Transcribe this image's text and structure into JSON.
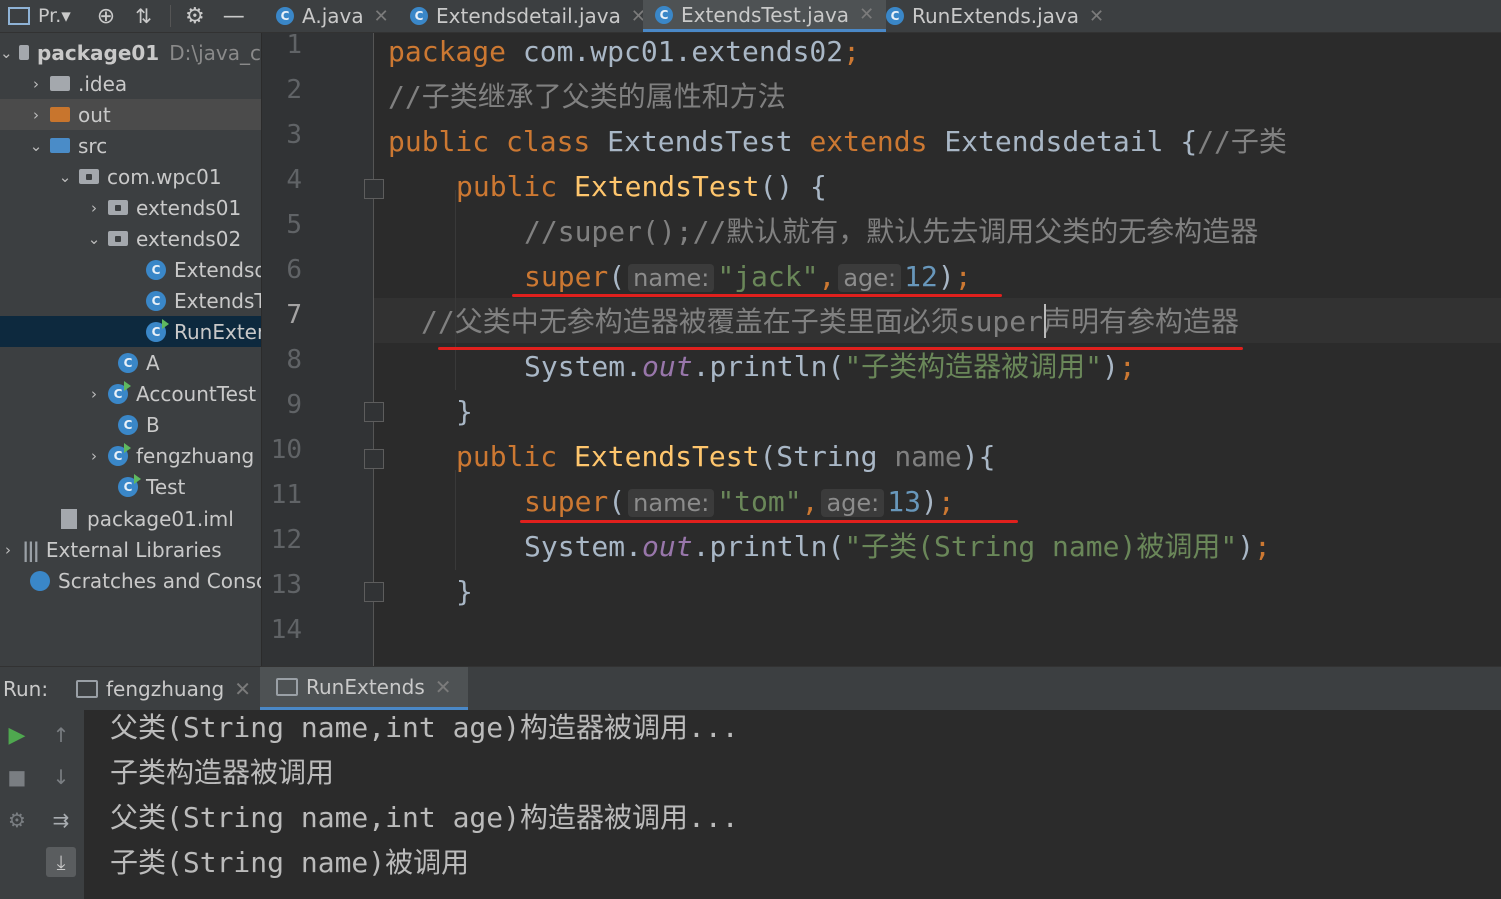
{
  "toolbar": {
    "project_label": "Pr.▾"
  },
  "tabs": [
    {
      "label": "A.java",
      "active": false
    },
    {
      "label": "Extendsdetail.java",
      "active": false
    },
    {
      "label": "ExtendsTest.java",
      "active": true
    },
    {
      "label": "RunExtends.java",
      "active": false
    }
  ],
  "tree": [
    {
      "label": "package01",
      "hint": "D:\\java_c",
      "icon": "module-folder-icon"
    },
    {
      "label": ".idea",
      "icon": "folder-icon"
    },
    {
      "label": "out",
      "icon": "folder-icon"
    },
    {
      "label": "src",
      "icon": "source-folder-icon"
    },
    {
      "label": "com.wpc01",
      "icon": "package-icon"
    },
    {
      "label": "extends01",
      "icon": "package-icon"
    },
    {
      "label": "extends02",
      "icon": "package-icon"
    },
    {
      "label": "Extendsd",
      "icon": "class-icon"
    },
    {
      "label": "ExtendsT",
      "icon": "class-icon"
    },
    {
      "label": "RunExten",
      "icon": "runnable-class-icon"
    },
    {
      "label": "A",
      "icon": "class-icon"
    },
    {
      "label": "AccountTest",
      "icon": "runnable-class-icon"
    },
    {
      "label": "B",
      "icon": "class-icon"
    },
    {
      "label": "fengzhuang",
      "icon": "runnable-class-icon"
    },
    {
      "label": "Test",
      "icon": "runnable-class-icon"
    },
    {
      "label": "package01.iml",
      "icon": "iml-file-icon"
    },
    {
      "label": "External Libraries",
      "icon": "libraries-icon"
    },
    {
      "label": "Scratches and Consol",
      "icon": "scratches-icon"
    }
  ],
  "editor": {
    "line_numbers": [
      "1",
      "2",
      "3",
      "4",
      "5",
      "6",
      "7",
      "8",
      "9",
      "10",
      "11",
      "12",
      "13",
      "14"
    ],
    "current_line": "7",
    "code": {
      "l1_kw": "package ",
      "l1_pkg": "com.wpc01.extends02",
      "l1_semi": ";",
      "l2_comment": "//子类继承了父类的属性和方法",
      "l3_kw1": "public class ",
      "l3_name": "ExtendsTest ",
      "l3_kw2": "extends ",
      "l3_parent": "Extendsdetail ",
      "l3_brace": "{",
      "l3_comment": "//子类",
      "l4_kw": "public ",
      "l4_fn": "ExtendsTest",
      "l4_rest": "() {",
      "l5_comment": "//super();//默认就有，默认先去调用父类的无参构造器",
      "l6_kw": "super",
      "l6_open": "(",
      "l6_hint1": "name:",
      "l6_str": "\"jack\"",
      "l6_comma": ",",
      "l6_hint2": "age:",
      "l6_num": "12",
      "l6_close": ")",
      "l6_semi": ";",
      "l7_comment": "//父类中无参构造器被覆盖在子类里面必须super声明有参构造器",
      "l8_pre": "System.",
      "l8_out": "out",
      "l8_mid": ".println(",
      "l8_str": "\"子类构造器被调用\"",
      "l8_close": ")",
      "l8_semi": ";",
      "l9_brace": "}",
      "l10_kw": "public ",
      "l10_fn": "ExtendsTest",
      "l10_open": "(String ",
      "l10_param": "name",
      "l10_close": "){",
      "l11_kw": "super",
      "l11_open": "(",
      "l11_hint1": "name:",
      "l11_str": "\"tom\"",
      "l11_comma": ",",
      "l11_hint2": "age:",
      "l11_num": "13",
      "l11_close": ")",
      "l11_semi": ";",
      "l12_pre": "System.",
      "l12_out": "out",
      "l12_mid": ".println(",
      "l12_str": "\"子类(String name)被调用\"",
      "l12_close": ")",
      "l12_semi": ";",
      "l13_brace": "}"
    }
  },
  "run": {
    "label": "Run:",
    "tabs": [
      {
        "label": "fengzhuang",
        "active": false
      },
      {
        "label": "RunExtends",
        "active": true
      }
    ],
    "output": [
      "父类(String name,int age)构造器被调用...",
      "子类构造器被调用",
      "父类(String name,int age)构造器被调用...",
      "子类(String name)被调用"
    ]
  }
}
